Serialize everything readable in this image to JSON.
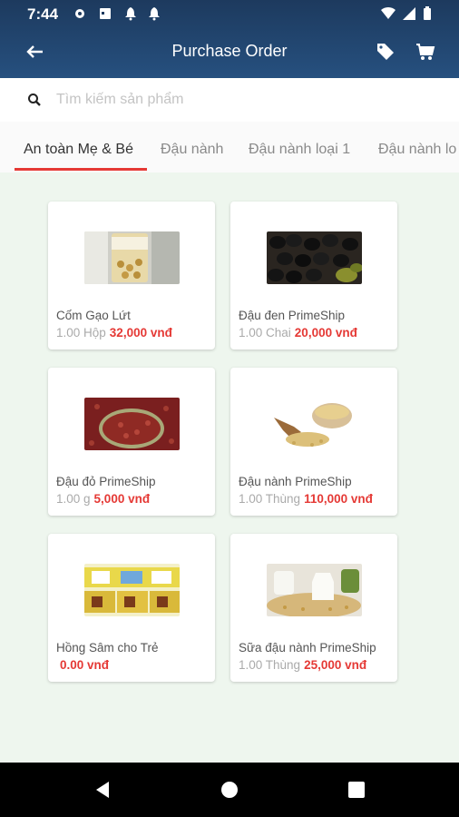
{
  "status_bar": {
    "time": "7:44"
  },
  "app_bar": {
    "title": "Purchase Order"
  },
  "search": {
    "placeholder": "Tìm kiếm sản phẩm"
  },
  "tabs": [
    {
      "label": "An toàn Mẹ & Bé"
    },
    {
      "label": "Đậu nành"
    },
    {
      "label": "Đậu nành loại 1"
    },
    {
      "label": "Đậu nành lo"
    }
  ],
  "products": [
    {
      "name": "Cốm Gạo Lứt",
      "qty": "1.00 Hộp",
      "price": "32,000 vnđ"
    },
    {
      "name": "Đậu đen PrimeShip",
      "qty": "1.00 Chai",
      "price": "20,000 vnđ"
    },
    {
      "name": "Đậu đỏ PrimeShip",
      "qty": "1.00 g",
      "price": "5,000 vnđ"
    },
    {
      "name": "Đậu nành PrimeShip",
      "qty": "1.00 Thùng",
      "price": "110,000 vnđ"
    },
    {
      "name": "Hồng Sâm cho Trẻ",
      "qty": "",
      "price": "0.00 vnđ"
    },
    {
      "name": "Sữa đậu nành PrimeShip",
      "qty": "1.00 Thùng",
      "price": "25,000 vnđ"
    }
  ],
  "colors": {
    "primary": "#1d3a5e",
    "accent": "#e53935",
    "background": "#eef6ee"
  }
}
